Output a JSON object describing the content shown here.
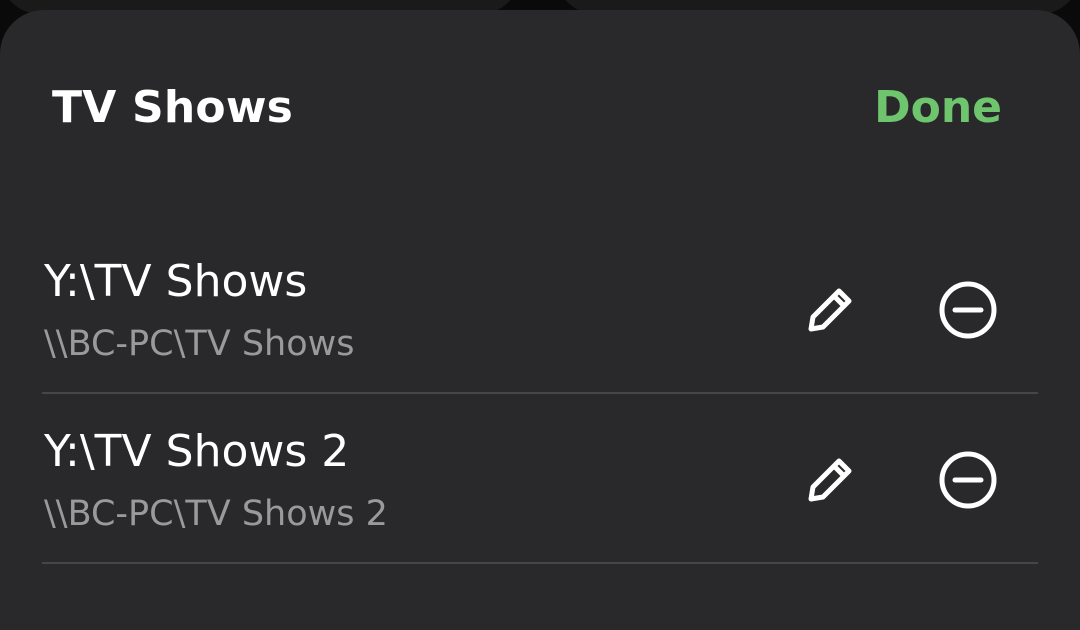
{
  "header": {
    "title": "TV Shows",
    "done_label": "Done"
  },
  "colors": {
    "accent": "#6ec56e",
    "sheet_background": "#29292b",
    "primary_text": "#ffffff",
    "secondary_text": "#9a9a9c",
    "divider": "#464648"
  },
  "shares": [
    {
      "name": "Y:\\TV Shows",
      "path": "\\\\BC-PC\\TV Shows",
      "edit_icon": "pencil-icon",
      "remove_icon": "minus-circle-icon"
    },
    {
      "name": "Y:\\TV Shows 2",
      "path": "\\\\BC-PC\\TV Shows 2",
      "edit_icon": "pencil-icon",
      "remove_icon": "minus-circle-icon"
    }
  ]
}
